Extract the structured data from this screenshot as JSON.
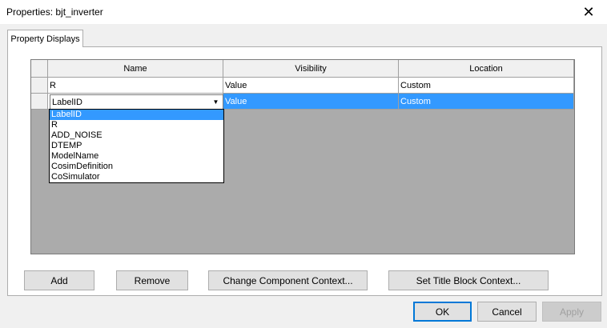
{
  "window": {
    "title": "Properties: bjt_inverter",
    "close_glyph": "✕"
  },
  "tabs": [
    {
      "label": "Property Displays"
    }
  ],
  "grid": {
    "columns": [
      "Name",
      "Visibility",
      "Location"
    ],
    "rows": [
      {
        "name": "R",
        "visibility": "Value",
        "location": "Custom"
      },
      {
        "name": "LabelID",
        "visibility": "Value",
        "location": "Custom"
      }
    ]
  },
  "dropdown": {
    "selected": "LabelID",
    "options": [
      "LabelID",
      "R",
      "ADD_NOISE",
      "DTEMP",
      "ModelName",
      "CosimDefinition",
      "CoSimulator"
    ]
  },
  "buttons": {
    "add": "Add",
    "remove": "Remove",
    "change_context": "Change Component Context...",
    "set_title_block": "Set Title Block Context...",
    "ok": "OK",
    "cancel": "Cancel",
    "apply": "Apply"
  },
  "colors": {
    "selection": "#3399ff",
    "default_border": "#0078d7"
  }
}
